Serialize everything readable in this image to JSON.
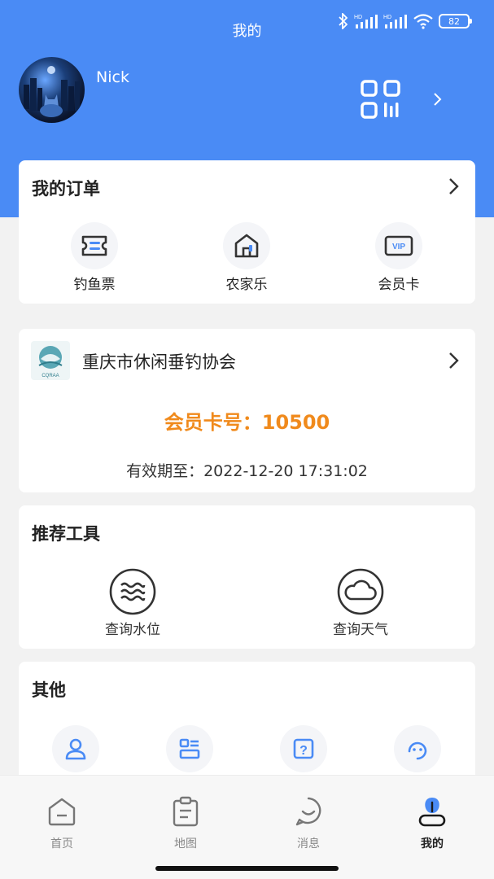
{
  "status_bar": {
    "battery": "82",
    "hd_label_1": "HD",
    "hd_label_2": "HD"
  },
  "header": {
    "title": "我的",
    "user_name": "Nick"
  },
  "orders": {
    "title": "我的订单",
    "items": [
      {
        "label": "钓鱼票",
        "icon": "ticket-icon"
      },
      {
        "label": "农家乐",
        "icon": "house-icon"
      },
      {
        "label": "会员卡",
        "icon": "vip-card-icon",
        "badge": "VIP"
      }
    ]
  },
  "association": {
    "name": "重庆市休闲垂钓协会",
    "logo_text": "CQRAA",
    "card_number": "会员卡号：10500",
    "expiry": "有效期至：2022-12-20 17:31:02"
  },
  "tools": {
    "title": "推荐工具",
    "items": [
      {
        "label": "查询水位",
        "icon": "water-level-icon"
      },
      {
        "label": "查询天气",
        "icon": "weather-icon"
      }
    ]
  },
  "other": {
    "title": "其他",
    "items": [
      {
        "icon": "person-icon"
      },
      {
        "icon": "list-icon"
      },
      {
        "icon": "help-icon",
        "glyph": "?"
      },
      {
        "icon": "customer-service-icon"
      }
    ]
  },
  "tabbar": {
    "tabs": [
      {
        "label": "首页",
        "icon": "home-icon"
      },
      {
        "label": "地图",
        "icon": "map-icon"
      },
      {
        "label": "消息",
        "icon": "message-icon"
      },
      {
        "label": "我的",
        "icon": "profile-icon",
        "active": true
      }
    ]
  },
  "colors": {
    "primary": "#4a8bf5",
    "accent_orange": "#f08a1c",
    "icon_blue": "#4a8bf5",
    "background": "#f2f2f2"
  }
}
